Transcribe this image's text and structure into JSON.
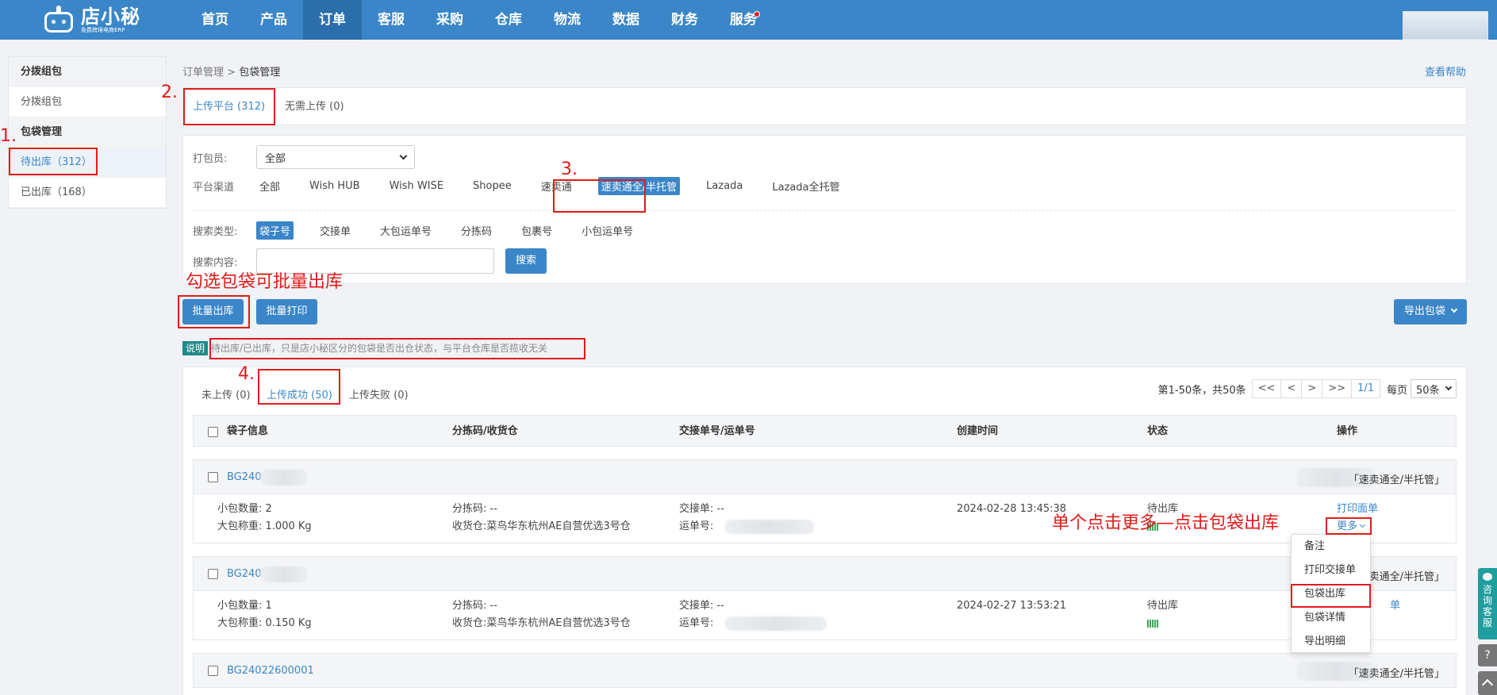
{
  "brand": {
    "name": "店小秘",
    "tagline": "免费跨境电商ERP"
  },
  "nav": [
    {
      "label": "首页"
    },
    {
      "label": "产品"
    },
    {
      "label": "订单"
    },
    {
      "label": "客服"
    },
    {
      "label": "采购"
    },
    {
      "label": "仓库"
    },
    {
      "label": "物流"
    },
    {
      "label": "数据"
    },
    {
      "label": "财务"
    },
    {
      "label": "服务"
    }
  ],
  "nav_active": "订单",
  "sidebar": {
    "group1": "分拨组包",
    "group1_items": [
      {
        "label": "分拨组包"
      }
    ],
    "group2": "包袋管理",
    "group2_items": [
      {
        "label": "待出库（312）"
      },
      {
        "label": "已出库（168）"
      }
    ]
  },
  "breadcrumb": {
    "parent": "订单管理",
    "sep": ">",
    "current": "包袋管理"
  },
  "help_link": "查看帮助",
  "top_tabs": [
    {
      "label": "上传平台 (312)"
    },
    {
      "label": "无需上传 (0)"
    }
  ],
  "filter": {
    "packer_label": "打包员:",
    "packer_value": "全部",
    "channel_label": "平台渠道",
    "channels": [
      "全部",
      "Wish HUB",
      "Wish WISE",
      "Shopee",
      "速卖通",
      "速卖通全/半托管",
      "Lazada",
      "Lazada全托管"
    ],
    "channel_selected": "速卖通全/半托管",
    "search_type_label": "搜索类型:",
    "search_types": [
      "袋子号",
      "交接单",
      "大包运单号",
      "分拣码",
      "包裹号",
      "小包运单号"
    ],
    "search_type_selected": "袋子号",
    "search_content_label": "搜索内容:",
    "search_button": "搜索"
  },
  "actions": {
    "batch_out": "批量出库",
    "batch_print": "批量打印",
    "export": "导出包袋"
  },
  "note": {
    "tag": "说明",
    "text": "待出库/已出库，只是店小秘区分的包袋是否出仓状态，与平台仓库是否揽收无关"
  },
  "sub_tabs": [
    {
      "label": "未上传 (0)"
    },
    {
      "label": "上传成功 (50)"
    },
    {
      "label": "上传失败 (0)"
    }
  ],
  "pager": {
    "summary": "第1-50条，共50条",
    "first": "<<",
    "prev": "<",
    "next": ">",
    "last": ">>",
    "page": "1/1",
    "per_label": "每页",
    "per_value": "50条"
  },
  "table_headers": {
    "bag": "袋子信息",
    "sort": "分拣码/收货仓",
    "handover": "交接单号/运单号",
    "created": "创建时间",
    "status": "状态",
    "ops": "操作"
  },
  "rows": [
    {
      "bag_id": "BG2402",
      "platform": "「速卖通全/半托管」",
      "count_label": "小包数量:",
      "count": "2",
      "weight_label": "大包称重:",
      "weight": "1.000 Kg",
      "sort_label": "分拣码:",
      "sort": "--",
      "warehouse_label": "收货仓:",
      "warehouse": "菜鸟华东杭州AE自营优选3号仓",
      "handover_label": "交接单:",
      "handover": "--",
      "waybill_label": "运单号:",
      "created": "2024-02-28 13:45:38",
      "status": "待出库",
      "op1": "打印面单",
      "op2": "更多"
    },
    {
      "bag_id": "BG2402",
      "platform": "「速卖通全/半托管」",
      "count_label": "小包数量:",
      "count": "1",
      "weight_label": "大包称重:",
      "weight": "0.150 Kg",
      "sort_label": "分拣码:",
      "sort": "--",
      "warehouse_label": "收货仓:",
      "warehouse": "菜鸟华东杭州AE自营优选3号仓",
      "handover_label": "交接单:",
      "handover": "--",
      "waybill_label": "运单号:",
      "created": "2024-02-27 13:53:21",
      "status": "待出库",
      "op1": "单"
    },
    {
      "bag_id": "BG24022600001",
      "platform": "「速卖通全/半托管」"
    }
  ],
  "dropdown": [
    {
      "label": "备注"
    },
    {
      "label": "打印交接单"
    },
    {
      "label": "包袋出库"
    },
    {
      "label": "包袋详情"
    },
    {
      "label": "导出明细"
    }
  ],
  "annotations": {
    "n1": "1.",
    "n2": "2.",
    "n3": "3.",
    "n4": "4.",
    "batch_hint": "勾选包袋可批量出库",
    "single_hint": "单个点击更多—点击包袋出库"
  },
  "float": {
    "cs": "咨询客服",
    "q": "?"
  },
  "colors": {
    "primary": "#3a86c8",
    "annotation": "#e01b1b",
    "note_tag": "#1f8a8a"
  }
}
